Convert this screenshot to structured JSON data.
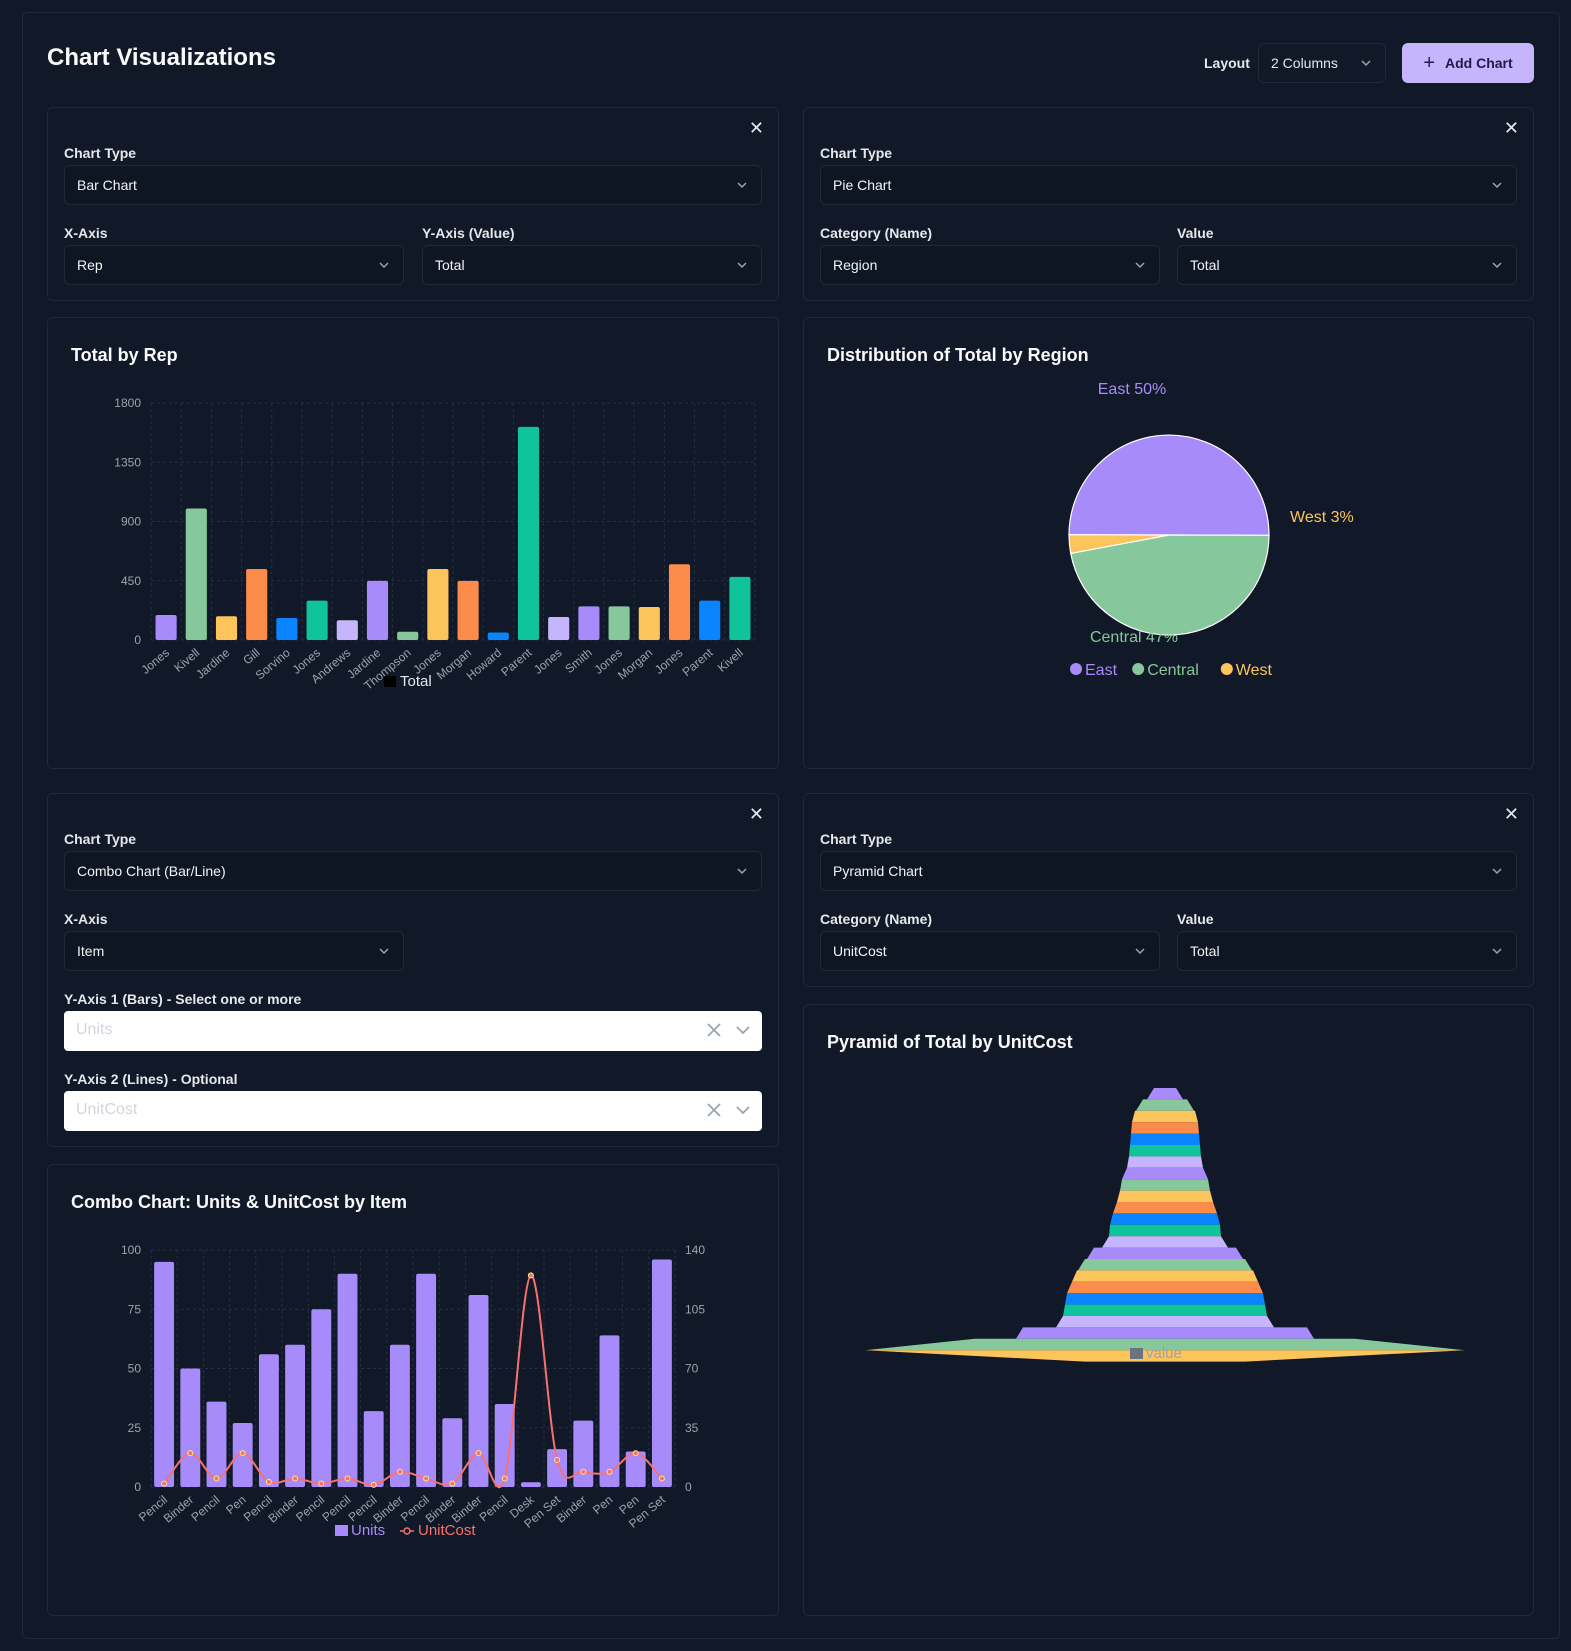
{
  "header": {
    "title": "Chart Visualizations",
    "layout_label": "Layout",
    "layout_value": "2 Columns",
    "add_chart_label": "Add Chart"
  },
  "panels": {
    "bar_config": {
      "chart_type_label": "Chart Type",
      "chart_type": "Bar Chart",
      "x_label": "X-Axis",
      "x_value": "Rep",
      "y_label": "Y-Axis (Value)",
      "y_value": "Total"
    },
    "pie_config": {
      "chart_type_label": "Chart Type",
      "chart_type": "Pie Chart",
      "cat_label": "Category (Name)",
      "cat_value": "Region",
      "val_label": "Value",
      "val_value": "Total"
    },
    "combo_config": {
      "chart_type_label": "Chart Type",
      "chart_type": "Combo Chart (Bar/Line)",
      "x_label": "X-Axis",
      "x_value": "Item",
      "y1_label": "Y-Axis 1 (Bars) - Select one or more",
      "y1_value": "Units",
      "y2_label": "Y-Axis 2 (Lines) - Optional",
      "y2_value": "UnitCost"
    },
    "pyramid_config": {
      "chart_type_label": "Chart Type",
      "chart_type": "Pyramid Chart",
      "cat_label": "Category (Name)",
      "cat_value": "UnitCost",
      "val_label": "Value",
      "val_value": "Total"
    }
  },
  "chart_data": [
    {
      "type": "bar",
      "title": "Total by Rep",
      "categories": [
        "Jones",
        "Kivell",
        "Jardine",
        "Gill",
        "Sorvino",
        "Jones",
        "Andrews",
        "Jardine",
        "Thompson",
        "Jones",
        "Morgan",
        "Howard",
        "Parent",
        "Jones",
        "Smith",
        "Jones",
        "Morgan",
        "Jones",
        "Parent",
        "Kivell"
      ],
      "series": [
        {
          "name": "Total",
          "values": [
            190,
            999,
            180,
            539,
            167,
            299,
            150,
            449,
            63,
            539,
            449,
            57,
            1619,
            175,
            255,
            255,
            251,
            575,
            299,
            479
          ]
        }
      ],
      "colors": [
        "#a78bfa",
        "#86c89b",
        "#fcc55c",
        "#fb8c4a",
        "#0a84ff",
        "#10c49a",
        "#c4b5fd",
        "#a78bfa",
        "#86c89b",
        "#fcc55c",
        "#fb8c4a",
        "#0a84ff",
        "#10c49a",
        "#c4b5fd",
        "#a78bfa",
        "#86c89b",
        "#fcc55c",
        "#fb8c4a",
        "#0a84ff",
        "#10c49a"
      ],
      "yticks": [
        "0",
        "450",
        "900",
        "1350",
        "1800"
      ],
      "ylim": [
        0,
        1800
      ],
      "grid": true,
      "legend": "bottom"
    },
    {
      "type": "pie",
      "title": "Distribution of Total by Region",
      "slices": [
        {
          "name": "East",
          "value": 50,
          "label": "East 50%",
          "color": "#a78bfa"
        },
        {
          "name": "Central",
          "value": 47,
          "label": "Central 47%",
          "color": "#86c89b"
        },
        {
          "name": "West",
          "value": 3,
          "label": "West 3%",
          "color": "#fcc55c"
        }
      ],
      "legend": "bottom"
    },
    {
      "type": "bar",
      "title": "Combo Chart: Units & UnitCost by Item",
      "categories": [
        "Pencil",
        "Binder",
        "Pencil",
        "Pen",
        "Pencil",
        "Binder",
        "Pencil",
        "Pencil",
        "Pencil",
        "Binder",
        "Pencil",
        "Binder",
        "Binder",
        "Pencil",
        "Desk",
        "Pen Set",
        "Binder",
        "Pen",
        "Pen",
        "Pen Set"
      ],
      "series": [
        {
          "name": "Units",
          "kind": "bar",
          "axis": "left",
          "color": "#a78bfa",
          "values": [
            95,
            50,
            36,
            27,
            56,
            60,
            75,
            90,
            32,
            60,
            90,
            29,
            81,
            35,
            2,
            16,
            28,
            64,
            15,
            96
          ]
        },
        {
          "name": "UnitCost",
          "kind": "line",
          "axis": "right",
          "color": "#f87171",
          "values": [
            1.99,
            19.99,
            4.99,
            19.99,
            2.99,
            4.99,
            1.99,
            4.99,
            1.29,
            8.99,
            4.99,
            1.99,
            19.99,
            4.99,
            125,
            15.99,
            8.99,
            8.99,
            19.99,
            4.99
          ]
        }
      ],
      "yticks_left": [
        "0",
        "25",
        "50",
        "75",
        "100"
      ],
      "yticks_right": [
        "0",
        "35",
        "70",
        "105",
        "140"
      ],
      "ylim_left": [
        0,
        100
      ],
      "ylim_right": [
        0,
        140
      ],
      "grid": true,
      "legend": "bottom"
    },
    {
      "type": "bar",
      "subtype": "pyramid",
      "title": "Pyramid of Total by UnitCost",
      "legend_label": "value",
      "legend_color": "#6b7280",
      "layer_colors": [
        "#a78bfa",
        "#86c89b",
        "#fcc55c",
        "#fb8c4a",
        "#0a84ff",
        "#10c49a",
        "#c4b5fd"
      ]
    }
  ]
}
